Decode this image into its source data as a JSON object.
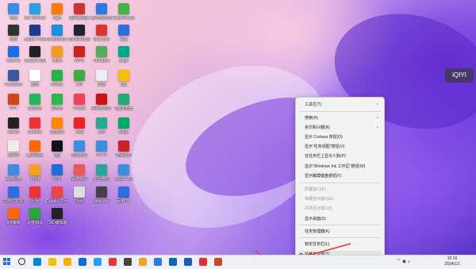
{
  "desktop": {
    "icons": [
      {
        "label": "电脑",
        "color": "#3a8ee6"
      },
      {
        "label": "ebo Remote",
        "color": "#2aa0e0"
      },
      {
        "label": "Bigo",
        "color": "#ff7a00"
      },
      {
        "label": "图片编辑器",
        "color": "#c33"
      },
      {
        "label": "腾讯电脑管家",
        "color": "#2a7be0"
      },
      {
        "label": "EasyRename",
        "color": "#46b04a"
      },
      {
        "label": "游戏",
        "color": "#333"
      },
      {
        "label": "Adobe Photoshop",
        "color": "#1e3a8a"
      },
      {
        "label": "CleanMaster",
        "color": "#1d8fe0"
      },
      {
        "label": "BaiduNetdisk",
        "color": "#223"
      },
      {
        "label": "Microsoft",
        "color": "#d33"
      },
      {
        "label": "百度",
        "color": "#2a6ee0"
      },
      {
        "label": "Internet",
        "color": "#1e6ee0"
      },
      {
        "label": "Counter Strike",
        "color": "#222"
      },
      {
        "label": "Video",
        "color": "#f29c1f"
      },
      {
        "label": "WPS",
        "color": "#c22"
      },
      {
        "label": "Notepad",
        "color": "#5a5"
      },
      {
        "label": "Edge",
        "color": "#0a8"
      },
      {
        "label": "Facebook",
        "color": "#3b5998"
      },
      {
        "label": "迅雷",
        "color": "#fff"
      },
      {
        "label": "Weixin",
        "color": "#2ab24a"
      },
      {
        "label": "GO",
        "color": "#4a4"
      },
      {
        "label": "文档",
        "color": "#eee"
      },
      {
        "label": "QQ",
        "color": "#f2c200"
      },
      {
        "label": "PPT",
        "color": "#d0451b"
      },
      {
        "label": "QQ音乐",
        "color": "#1fb85a"
      },
      {
        "label": "爱奇艺",
        "color": "#2aba4a"
      },
      {
        "label": "Photos",
        "color": "#e45"
      },
      {
        "label": "网易云音乐",
        "color": "#c11"
      },
      {
        "label": "QQ浏览器",
        "color": "#2a7"
      },
      {
        "label": "Steam",
        "color": "#222"
      },
      {
        "label": "Chrome",
        "color": "#e33"
      },
      {
        "label": "QQ影音",
        "color": "#f80"
      },
      {
        "label": "火绒",
        "color": "#e22"
      },
      {
        "label": "360",
        "color": "#2a9"
      },
      {
        "label": "Edge",
        "color": "#0a6"
      },
      {
        "label": "记事本",
        "color": "#eee"
      },
      {
        "label": "腾讯视频",
        "color": "#f60"
      },
      {
        "label": "QQ",
        "color": "#111"
      },
      {
        "label": "迅雷影音",
        "color": "#3a8ee6"
      },
      {
        "label": "PPTV",
        "color": "#3a8ee6"
      },
      {
        "label": "酷我音乐",
        "color": "#c22"
      },
      {
        "label": "百度网盘",
        "color": "#3a8ee6"
      },
      {
        "label": "123dl",
        "color": "#f2a21f"
      },
      {
        "label": "钉钉",
        "color": "#1e6ee0"
      },
      {
        "label": "百度翻译",
        "color": "#e55"
      },
      {
        "label": "企业微信",
        "color": "#2a9"
      },
      {
        "label": "2023 1 13",
        "color": "#3a8ee6"
      },
      {
        "label": "2345PDF转换",
        "color": "#2a6ee0"
      },
      {
        "label": "迅雷",
        "color": "#e33"
      },
      {
        "label": "Google Chrome",
        "color": "#e44"
      },
      {
        "label": "Docs",
        "color": "#ddd"
      },
      {
        "label": "geek.exe",
        "color": "#444"
      },
      {
        "label": "百度TV",
        "color": "#2a6ee0"
      },
      {
        "label": "pdf编辑",
        "color": "#f60"
      },
      {
        "label": "百度翻译",
        "color": "#2a3"
      },
      {
        "label": "CAD编辑器",
        "color": "#222"
      }
    ]
  },
  "overlay": {
    "iqiyi_label": "iQIYI"
  },
  "context_menu": {
    "items": [
      {
        "label": "工具栏(T)",
        "submenu": true,
        "disabled": false
      },
      {
        "label": "搜索(H)",
        "submenu": true,
        "disabled": false
      },
      {
        "label": "资讯和兴趣(N)",
        "submenu": true,
        "disabled": false
      },
      {
        "label": "显示 Cortana 按钮(O)",
        "submenu": false,
        "disabled": false
      },
      {
        "label": "显示\"任务视图\"按钮(V)",
        "submenu": false,
        "disabled": false
      },
      {
        "label": "在任务栏上显示人脉(P)",
        "submenu": false,
        "disabled": false
      },
      {
        "label": "显示\"Windows Ink 工作区\"按钮(W)",
        "submenu": false,
        "disabled": false
      },
      {
        "label": "显示触摸键盘按钮(Y)",
        "submenu": false,
        "disabled": false
      },
      {
        "label": "层叠窗口(D)",
        "submenu": false,
        "disabled": true
      },
      {
        "label": "堆叠显示窗口(E)",
        "submenu": false,
        "disabled": true
      },
      {
        "label": "并排显示窗口(I)",
        "submenu": false,
        "disabled": true
      },
      {
        "label": "显示桌面(S)",
        "submenu": false,
        "disabled": false
      },
      {
        "label": "任务管理器(K)",
        "submenu": false,
        "disabled": false
      },
      {
        "label": "锁定任务栏(L)",
        "submenu": false,
        "disabled": false
      },
      {
        "label": "任务栏设置(T)",
        "submenu": false,
        "disabled": false,
        "highlighted": true,
        "icon": "gear-icon"
      }
    ]
  },
  "taskbar": {
    "apps": [
      "start-icon",
      "search-icon",
      "edge-icon",
      "file-explorer-icon",
      "folder-icon",
      "mail-icon",
      "photos-icon",
      "media-player-icon",
      "store-icon",
      "weather-icon",
      "security-icon",
      "outlook-icon",
      "word-icon",
      "wps-icon",
      "ppt-icon"
    ],
    "clock_time": "10:16",
    "clock_date": "2024/1/1"
  },
  "colors": {
    "menu_bg": "#f3f3f3",
    "taskbar_bg": "#eef0f5",
    "arrow": "#e53935"
  }
}
